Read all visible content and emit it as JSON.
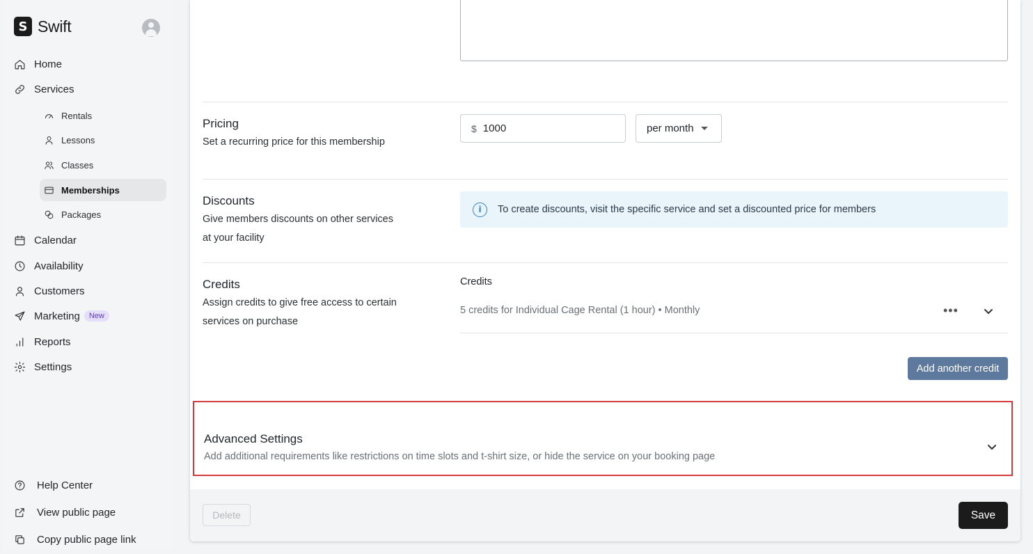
{
  "brand": {
    "logo_letter": "S",
    "name": "Swift"
  },
  "sidebar": {
    "items": [
      {
        "label": "Home",
        "icon": "home-icon"
      },
      {
        "label": "Services",
        "icon": "link-icon"
      },
      {
        "label": "Calendar",
        "icon": "calendar-icon"
      },
      {
        "label": "Availability",
        "icon": "clock-icon"
      },
      {
        "label": "Customers",
        "icon": "user-icon"
      },
      {
        "label": "Marketing",
        "icon": "send-icon",
        "badge": "New"
      },
      {
        "label": "Reports",
        "icon": "bar-chart-icon"
      },
      {
        "label": "Settings",
        "icon": "gear-icon"
      }
    ],
    "sub_items": [
      {
        "label": "Rentals",
        "icon": "gauge-icon"
      },
      {
        "label": "Lessons",
        "icon": "user-icon"
      },
      {
        "label": "Classes",
        "icon": "users-icon"
      },
      {
        "label": "Memberships",
        "icon": "card-icon",
        "active": true
      },
      {
        "label": "Packages",
        "icon": "package-icon"
      }
    ],
    "bottom_items": [
      {
        "label": "Help Center",
        "icon": "help-icon"
      },
      {
        "label": "View public page",
        "icon": "external-link-icon"
      },
      {
        "label": "Copy public page link",
        "icon": "copy-icon"
      }
    ]
  },
  "pricing": {
    "title": "Pricing",
    "description": "Set a recurring price for this membership",
    "currency_symbol": "$",
    "amount": "1000",
    "period": "per month"
  },
  "discounts": {
    "title": "Discounts",
    "description_line1": "Give members discounts on other services",
    "description_line2": "at your facility",
    "info": "To create discounts, visit the specific service and set a discounted price for members"
  },
  "credits": {
    "title": "Credits",
    "description_line1": "Assign credits to give free access to certain",
    "description_line2": "services on purchase",
    "list_label": "Credits",
    "rows": [
      {
        "text": "5 credits for Individual Cage Rental (1 hour) • Monthly"
      }
    ],
    "add_button": "Add another credit"
  },
  "advanced": {
    "title": "Advanced Settings",
    "description": "Add additional requirements like restrictions on time slots and t-shirt size, or hide the service on your booking page"
  },
  "footer": {
    "delete_label": "Delete",
    "save_label": "Save"
  },
  "colors": {
    "highlight": "#d33a3a",
    "info_bg": "#eaf4fb",
    "primary_button": "#5d7a9e",
    "save_button": "#1b1b1b"
  }
}
